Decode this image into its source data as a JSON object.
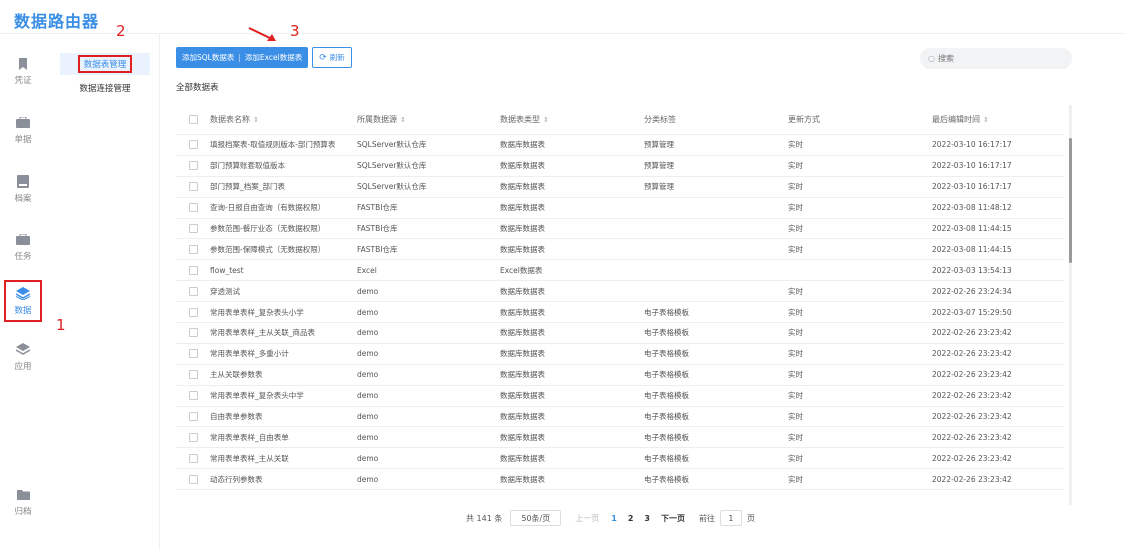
{
  "app_title": "数据路由器",
  "left_nav": [
    {
      "label": "凭证",
      "icon": "bookmark-icon"
    },
    {
      "label": "单据",
      "icon": "briefcase-icon"
    },
    {
      "label": "档案",
      "icon": "book-icon"
    },
    {
      "label": "任务",
      "icon": "briefcase-icon"
    },
    {
      "label": "数据",
      "icon": "layers-icon",
      "active": true
    },
    {
      "label": "应用",
      "icon": "layers-icon"
    },
    {
      "label": "归档",
      "icon": "folder-icon"
    }
  ],
  "sub_nav": [
    {
      "label": "数据表管理",
      "active": true
    },
    {
      "label": "数据连接管理"
    }
  ],
  "annotations": {
    "n1": "1",
    "n2": "2",
    "n3": "3"
  },
  "toolbar": {
    "add_sql": "添加SQL数据表",
    "separator": "|",
    "add_excel": "添加Excel数据表",
    "refresh": "刷新"
  },
  "search": {
    "placeholder": "搜索"
  },
  "section_title": "全部数据表",
  "table": {
    "headers": [
      "数据表名称",
      "所属数据源",
      "数据表类型",
      "分类标签",
      "更新方式",
      "最后编辑时间"
    ],
    "rows": [
      [
        "填报档案表-取值规则版本-部门预算表",
        "SQLServer默认仓库",
        "数据库数据表",
        "预算管理",
        "实时",
        "2022-03-10 16:17:17"
      ],
      [
        "部门预算账套取值版本",
        "SQLServer默认仓库",
        "数据库数据表",
        "预算管理",
        "实时",
        "2022-03-10 16:17:17"
      ],
      [
        "部门预算_档案_部门表",
        "SQLServer默认仓库",
        "数据库数据表",
        "预算管理",
        "实时",
        "2022-03-10 16:17:17"
      ],
      [
        "查询-日报自由查询（有数据权限）",
        "FASTBI仓库",
        "数据库数据表",
        "",
        "实时",
        "2022-03-08 11:48:12"
      ],
      [
        "参数范围-餐厅业态（无数据权限）",
        "FASTBI仓库",
        "数据库数据表",
        "",
        "实时",
        "2022-03-08 11:44:15"
      ],
      [
        "参数范围-保障模式（无数据权限）",
        "FASTBI仓库",
        "数据库数据表",
        "",
        "实时",
        "2022-03-08 11:44:15"
      ],
      [
        "flow_test",
        "Excel",
        "Excel数据表",
        "",
        "",
        "2022-03-03 13:54:13"
      ],
      [
        "穿透测试",
        "demo",
        "数据库数据表",
        "",
        "实时",
        "2022-02-26 23:24:34"
      ],
      [
        "常用表单表样_复杂表头小学",
        "demo",
        "数据库数据表",
        "电子表格模板",
        "实时",
        "2022-03-07 15:29:50"
      ],
      [
        "常用表单表样_主从关联_商品表",
        "demo",
        "数据库数据表",
        "电子表格模板",
        "实时",
        "2022-02-26 23:23:42"
      ],
      [
        "常用表单表样_多重小计",
        "demo",
        "数据库数据表",
        "电子表格模板",
        "实时",
        "2022-02-26 23:23:42"
      ],
      [
        "主从关联参数表",
        "demo",
        "数据库数据表",
        "电子表格模板",
        "实时",
        "2022-02-26 23:23:42"
      ],
      [
        "常用表单表样_复杂表头中学",
        "demo",
        "数据库数据表",
        "电子表格模板",
        "实时",
        "2022-02-26 23:23:42"
      ],
      [
        "自由表单参数表",
        "demo",
        "数据库数据表",
        "电子表格模板",
        "实时",
        "2022-02-26 23:23:42"
      ],
      [
        "常用表单表样_自由表单",
        "demo",
        "数据库数据表",
        "电子表格模板",
        "实时",
        "2022-02-26 23:23:42"
      ],
      [
        "常用表单表样_主从关联",
        "demo",
        "数据库数据表",
        "电子表格模板",
        "实时",
        "2022-02-26 23:23:42"
      ],
      [
        "动态行列参数表",
        "demo",
        "数据库数据表",
        "电子表格模板",
        "实时",
        "2022-02-26 23:23:42"
      ]
    ]
  },
  "pagination": {
    "total": "共 141 条",
    "page_size": "50条/页",
    "prev": "上一页",
    "pages": [
      "1",
      "2",
      "3"
    ],
    "current_page": "1",
    "next": "下一页",
    "goto_label": "前往",
    "goto_value": "1",
    "goto_suffix": "页"
  },
  "colors": {
    "accent": "#3a8ee6",
    "annotation": "#e02020"
  }
}
